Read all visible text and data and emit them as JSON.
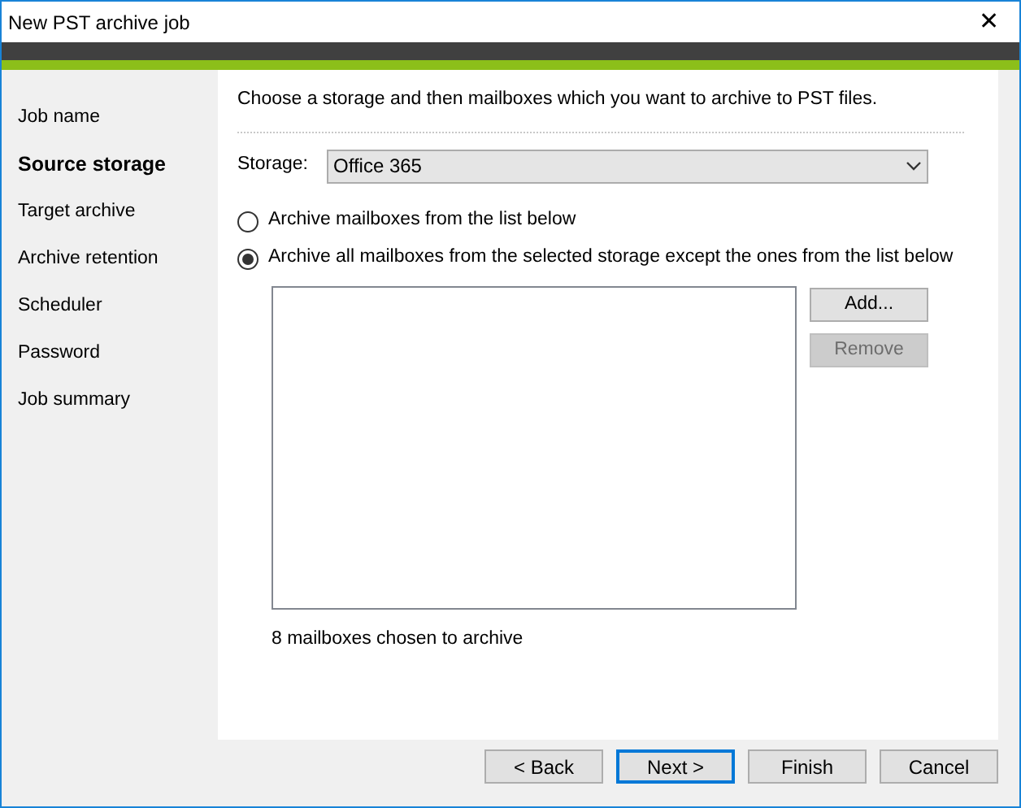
{
  "window": {
    "title": "New PST archive job",
    "close": "✕"
  },
  "sidebar": {
    "items": [
      {
        "label": "Job name",
        "selected": false
      },
      {
        "label": "Source storage",
        "selected": true
      },
      {
        "label": "Target archive",
        "selected": false
      },
      {
        "label": "Archive retention",
        "selected": false
      },
      {
        "label": "Scheduler",
        "selected": false
      },
      {
        "label": "Password",
        "selected": false
      },
      {
        "label": "Job summary",
        "selected": false
      }
    ]
  },
  "content": {
    "instruction": "Choose a storage and then mailboxes which you want to archive to PST files.",
    "storage": {
      "label": "Storage:",
      "value": "Office 365"
    },
    "options": [
      {
        "label": "Archive mailboxes from the list below",
        "selected": false
      },
      {
        "label": "Archive all mailboxes from the selected storage except the ones from the list below",
        "selected": true
      }
    ],
    "list_buttons": [
      {
        "label": "Add...",
        "disabled": false
      },
      {
        "label": "Remove",
        "disabled": true
      }
    ],
    "status": "8 mailboxes chosen to archive"
  },
  "footer_buttons": [
    {
      "label": "< Back",
      "default": false
    },
    {
      "label": "Next >",
      "default": true
    },
    {
      "label": "Finish",
      "default": false
    },
    {
      "label": "Cancel",
      "default": false
    }
  ]
}
